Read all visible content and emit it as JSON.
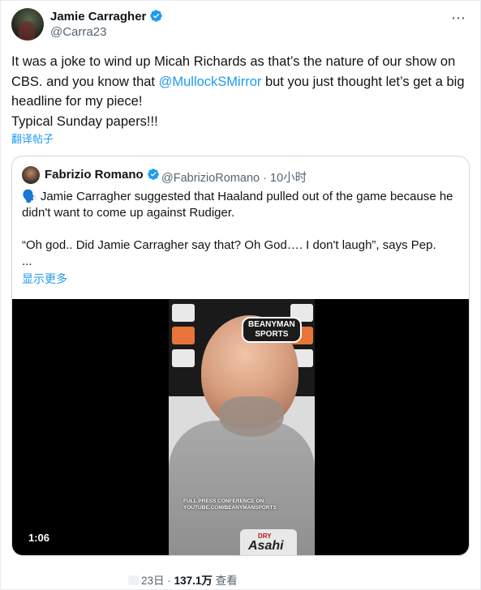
{
  "author": {
    "name": "Jamie Carragher",
    "handle": "@Carra23"
  },
  "tweet": {
    "line1": "It was a joke to wind up Micah Richards as that’s the nature of our show on CBS. and you know that ",
    "mention": "@MullockSMirror",
    "line2": " but you just thought let’s get a big headline for my piece!",
    "line3": "Typical Sunday papers!!!",
    "translate": "翻译帖子"
  },
  "quote": {
    "name": "Fabrizio Romano",
    "handle": "@FabrizioRomano",
    "sep": "·",
    "time": "10小时",
    "p1": "🗣️ Jamie Carragher suggested that Haaland pulled out of the game because he didn't want to come up against Rudiger.",
    "p2": "“Oh god.. Did Jamie Carragher say that? Oh God…. I don't laugh”, says Pep.",
    "ellipsis": "...",
    "show_more": "显示更多"
  },
  "video": {
    "duration": "1:06",
    "brand_line1": "BEANYMAN",
    "brand_line2": "SPORTS",
    "caption": "FULL PRESS CONFERENCE ON YOUTUBE.COM/BEANYMANSPORTS",
    "can_dry": "DRY",
    "can_brand": "Asahi"
  },
  "footer": {
    "date": "23日",
    "dot": "·",
    "views_count": "137.1万",
    "views_label": "查看"
  },
  "more_icon": "more-icon",
  "colors": {
    "accent": "#1d9bf0",
    "text": "#0f1419",
    "muted": "#536471"
  }
}
